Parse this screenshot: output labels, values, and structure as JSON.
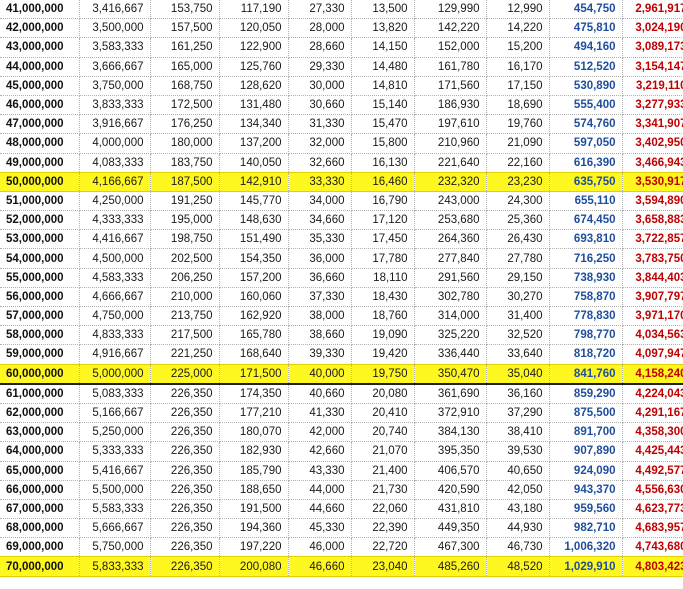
{
  "rows": [
    [
      "41,000,000",
      "3,416,667",
      "153,750",
      "117,190",
      "27,330",
      "13,500",
      "129,990",
      "12,990",
      "454,750",
      "2,961,917"
    ],
    [
      "42,000,000",
      "3,500,000",
      "157,500",
      "120,050",
      "28,000",
      "13,820",
      "142,220",
      "14,220",
      "475,810",
      "3,024,190"
    ],
    [
      "43,000,000",
      "3,583,333",
      "161,250",
      "122,900",
      "28,660",
      "14,150",
      "152,000",
      "15,200",
      "494,160",
      "3,089,173"
    ],
    [
      "44,000,000",
      "3,666,667",
      "165,000",
      "125,760",
      "29,330",
      "14,480",
      "161,780",
      "16,170",
      "512,520",
      "3,154,147"
    ],
    [
      "45,000,000",
      "3,750,000",
      "168,750",
      "128,620",
      "30,000",
      "14,810",
      "171,560",
      "17,150",
      "530,890",
      "3,219,110"
    ],
    [
      "46,000,000",
      "3,833,333",
      "172,500",
      "131,480",
      "30,660",
      "15,140",
      "186,930",
      "18,690",
      "555,400",
      "3,277,933"
    ],
    [
      "47,000,000",
      "3,916,667",
      "176,250",
      "134,340",
      "31,330",
      "15,470",
      "197,610",
      "19,760",
      "574,760",
      "3,341,907"
    ],
    [
      "48,000,000",
      "4,000,000",
      "180,000",
      "137,200",
      "32,000",
      "15,800",
      "210,960",
      "21,090",
      "597,050",
      "3,402,950"
    ],
    [
      "49,000,000",
      "4,083,333",
      "183,750",
      "140,050",
      "32,660",
      "16,130",
      "221,640",
      "22,160",
      "616,390",
      "3,466,943"
    ],
    [
      "50,000,000",
      "4,166,667",
      "187,500",
      "142,910",
      "33,330",
      "16,460",
      "232,320",
      "23,230",
      "635,750",
      "3,530,917"
    ],
    [
      "51,000,000",
      "4,250,000",
      "191,250",
      "145,770",
      "34,000",
      "16,790",
      "243,000",
      "24,300",
      "655,110",
      "3,594,890"
    ],
    [
      "52,000,000",
      "4,333,333",
      "195,000",
      "148,630",
      "34,660",
      "17,120",
      "253,680",
      "25,360",
      "674,450",
      "3,658,883"
    ],
    [
      "53,000,000",
      "4,416,667",
      "198,750",
      "151,490",
      "35,330",
      "17,450",
      "264,360",
      "26,430",
      "693,810",
      "3,722,857"
    ],
    [
      "54,000,000",
      "4,500,000",
      "202,500",
      "154,350",
      "36,000",
      "17,780",
      "277,840",
      "27,780",
      "716,250",
      "3,783,750"
    ],
    [
      "55,000,000",
      "4,583,333",
      "206,250",
      "157,200",
      "36,660",
      "18,110",
      "291,560",
      "29,150",
      "738,930",
      "3,844,403"
    ],
    [
      "56,000,000",
      "4,666,667",
      "210,000",
      "160,060",
      "37,330",
      "18,430",
      "302,780",
      "30,270",
      "758,870",
      "3,907,797"
    ],
    [
      "57,000,000",
      "4,750,000",
      "213,750",
      "162,920",
      "38,000",
      "18,760",
      "314,000",
      "31,400",
      "778,830",
      "3,971,170"
    ],
    [
      "58,000,000",
      "4,833,333",
      "217,500",
      "165,780",
      "38,660",
      "19,090",
      "325,220",
      "32,520",
      "798,770",
      "4,034,563"
    ],
    [
      "59,000,000",
      "4,916,667",
      "221,250",
      "168,640",
      "39,330",
      "19,420",
      "336,440",
      "33,640",
      "818,720",
      "4,097,947"
    ],
    [
      "60,000,000",
      "5,000,000",
      "225,000",
      "171,500",
      "40,000",
      "19,750",
      "350,470",
      "35,040",
      "841,760",
      "4,158,240"
    ],
    [
      "61,000,000",
      "5,083,333",
      "226,350",
      "174,350",
      "40,660",
      "20,080",
      "361,690",
      "36,160",
      "859,290",
      "4,224,043"
    ],
    [
      "62,000,000",
      "5,166,667",
      "226,350",
      "177,210",
      "41,330",
      "20,410",
      "372,910",
      "37,290",
      "875,500",
      "4,291,167"
    ],
    [
      "63,000,000",
      "5,250,000",
      "226,350",
      "180,070",
      "42,000",
      "20,740",
      "384,130",
      "38,410",
      "891,700",
      "4,358,300"
    ],
    [
      "64,000,000",
      "5,333,333",
      "226,350",
      "182,930",
      "42,660",
      "21,070",
      "395,350",
      "39,530",
      "907,890",
      "4,425,443"
    ],
    [
      "65,000,000",
      "5,416,667",
      "226,350",
      "185,790",
      "43,330",
      "21,400",
      "406,570",
      "40,650",
      "924,090",
      "4,492,577"
    ],
    [
      "66,000,000",
      "5,500,000",
      "226,350",
      "188,650",
      "44,000",
      "21,730",
      "420,590",
      "42,050",
      "943,370",
      "4,556,630"
    ],
    [
      "67,000,000",
      "5,583,333",
      "226,350",
      "191,500",
      "44,660",
      "22,060",
      "431,810",
      "43,180",
      "959,560",
      "4,623,773"
    ],
    [
      "68,000,000",
      "5,666,667",
      "226,350",
      "194,360",
      "45,330",
      "22,390",
      "449,350",
      "44,930",
      "982,710",
      "4,683,957"
    ],
    [
      "69,000,000",
      "5,750,000",
      "226,350",
      "197,220",
      "46,000",
      "22,720",
      "467,300",
      "46,730",
      "1,006,320",
      "4,743,680"
    ],
    [
      "70,000,000",
      "5,833,333",
      "226,350",
      "200,080",
      "46,660",
      "23,040",
      "485,260",
      "48,520",
      "1,029,910",
      "4,803,423"
    ]
  ],
  "highlight_rows": [
    9,
    19,
    29
  ],
  "thick_border_rows": [
    19
  ],
  "colors": {
    "highlight": "#fff820",
    "col9_text": "#1f4e9c",
    "col10_text": "#c00000"
  }
}
